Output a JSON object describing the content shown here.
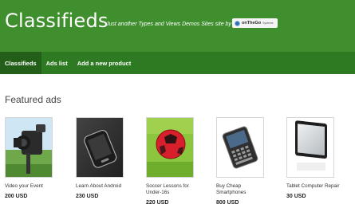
{
  "header": {
    "site_title": "Classifieds",
    "tagline": "Just another Types and Views Demos Sites site by",
    "brand_name": "onTheGo",
    "brand_sub": "Systems",
    "background_color": "#3f8f2e"
  },
  "nav": {
    "items": [
      {
        "label": "Classifieds",
        "active": true
      },
      {
        "label": "Ads list",
        "active": false
      },
      {
        "label": "Add a new product",
        "active": false
      }
    ],
    "background_color": "#2e7a22"
  },
  "featured": {
    "title": "Featured ads",
    "ads": [
      {
        "title": "Video your Event",
        "price": "200 USD",
        "image_icon": "camcorder"
      },
      {
        "title": "Learn About Android",
        "price": "230 USD",
        "image_icon": "smartphone"
      },
      {
        "title": "Soccer Lessons for Under-16s",
        "price": "220 USD",
        "image_icon": "soccer-ball"
      },
      {
        "title": "Buy Cheap Smartphones",
        "price": "800 USD",
        "image_icon": "keyboard-phone"
      },
      {
        "title": "Tablet Computer Repair",
        "price": "30 USD",
        "image_icon": "tablet"
      }
    ]
  }
}
